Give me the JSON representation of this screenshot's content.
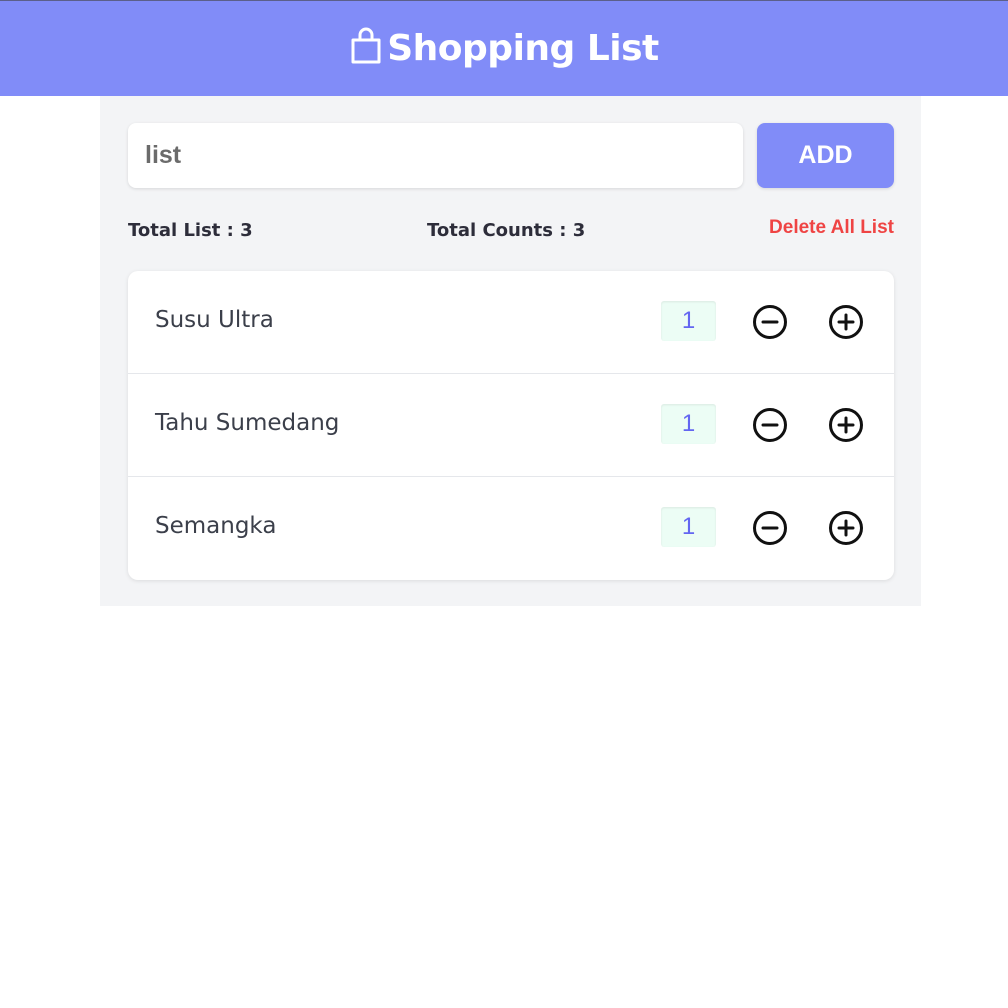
{
  "header": {
    "title": "Shopping List",
    "icon": "shopping-bag-icon"
  },
  "form": {
    "input_value": "",
    "placeholder": "list",
    "add_label": "ADD"
  },
  "stats": {
    "total_list": "Total List : 3",
    "total_counts": "Total Counts : 3"
  },
  "delete_all_label": "Delete All List",
  "items": [
    {
      "name": "Susu Ultra",
      "qty": "1"
    },
    {
      "name": "Tahu Sumedang",
      "qty": "1"
    },
    {
      "name": "Semangka",
      "qty": "1"
    }
  ],
  "colors": {
    "accent": "#818cf8",
    "danger": "#ef4444",
    "quantity_text": "#6366f1",
    "quantity_bg": "#ecfdf5",
    "panel_bg": "#f3f4f6"
  }
}
